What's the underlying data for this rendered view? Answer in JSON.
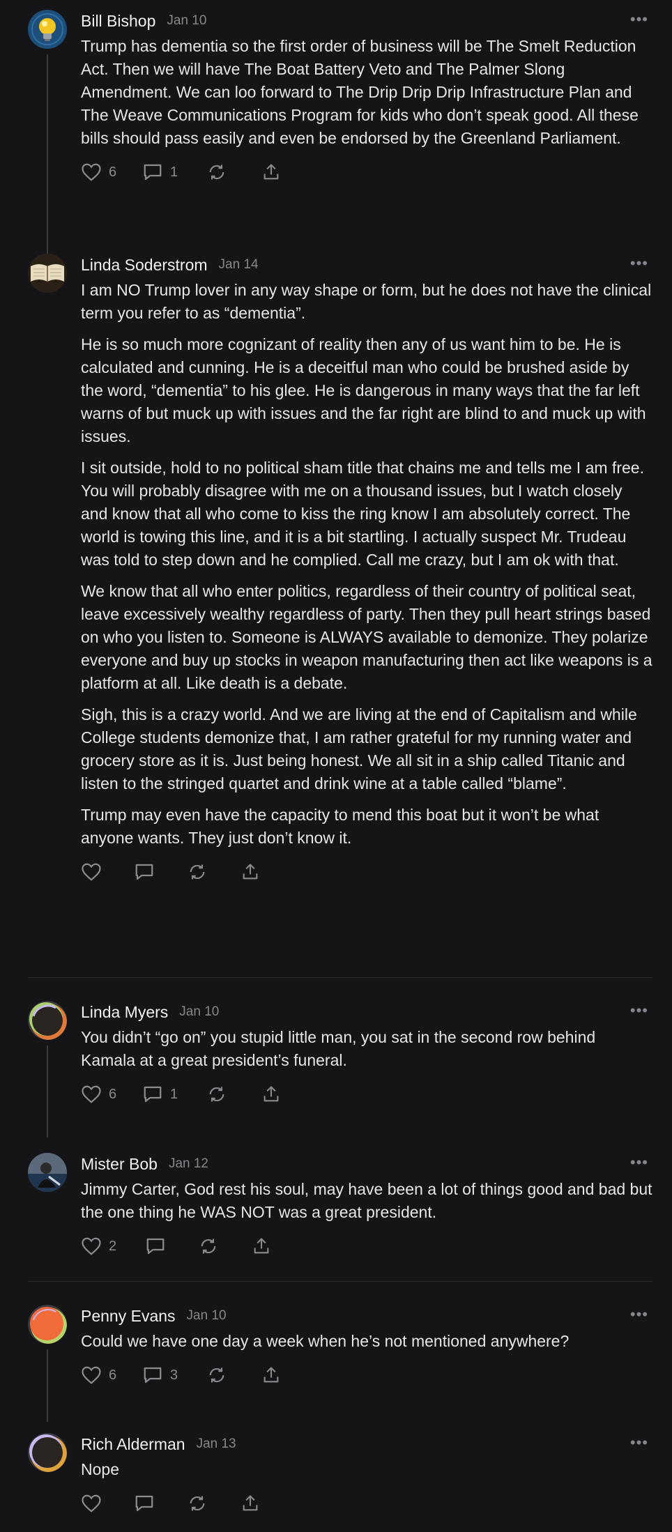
{
  "colors": {
    "background": "#151517",
    "text": "#e6e6e8",
    "muted": "#86868c",
    "thread_line": "#3a3a3e"
  },
  "icons": [
    "heart-icon",
    "comment-icon",
    "restack-icon",
    "share-icon",
    "more-icon"
  ],
  "comments": [
    {
      "name": "Bill Bishop",
      "date": "Jan 10",
      "avatar": "lightbulb",
      "paragraphs": [
        "Trump has dementia so the first order of business will be The Smelt Reduction Act. Then we will have The Boat Battery Veto and The Palmer Slong Amendment. We can loo forward to The Drip Drip Drip Infrastructure Plan and The Weave Communications Program for kids who don’t speak good. All these bills should pass easily and even be endorsed by the Greenland Parliament."
      ],
      "likes": "6",
      "replies": "1"
    },
    {
      "name": "Linda Soderstrom",
      "date": "Jan 14",
      "avatar": "book",
      "paragraphs": [
        "I am NO Trump lover in any way shape or form, but he does not have the clinical term you refer to as “dementia”.",
        "He is so much more cognizant of reality then any of us want him to be. He is calculated and cunning. He is a deceitful man who could be brushed aside by the word, “dementia” to his glee. He is dangerous in many ways that the far left warns of but muck up with issues and the far right are blind to and muck up with issues.",
        "I sit outside, hold to no political sham title that chains me and tells me I am free. You will probably disagree with me on a thousand issues, but I watch closely and know that all who come to kiss the ring know I am absolutely correct. The world is towing this line, and it is a bit startling. I actually suspect Mr. Trudeau was told to step down and he complied. Call me crazy, but I am ok with that.",
        "We know that all who enter politics, regardless of their country of political seat, leave excessively wealthy regardless of party. Then they pull heart strings based on who you listen to. Someone is ALWAYS available to demonize. They polarize everyone and buy up stocks in weapon manufacturing then act like weapons is a platform at all. Like death is a debate.",
        "Sigh, this is a crazy world. And we are living at the end of Capitalism and while College students demonize that, I am rather grateful for my running water and grocery store as it is. Just being honest. We all sit in a ship called Titanic and listen to the stringed quartet and drink wine at a table called “blame”.",
        "Trump may even have the capacity to mend this boat but it won’t be what anyone wants. They just don’t know it."
      ],
      "likes": "",
      "replies": ""
    },
    {
      "name": "Linda Myers",
      "date": "Jan 10",
      "avatar": "default",
      "paragraphs": [
        "You didn’t “go on” you stupid little man, you sat in the second row behind Kamala at a great president’s funeral."
      ],
      "likes": "6",
      "replies": "1"
    },
    {
      "name": "Mister Bob",
      "date": "Jan 12",
      "avatar": "photo",
      "paragraphs": [
        "Jimmy Carter, God rest his soul, may have been a lot of things good and bad but the one thing he WAS NOT was a great president."
      ],
      "likes": "2",
      "replies": ""
    },
    {
      "name": "Penny Evans",
      "date": "Jan 10",
      "avatar": "orange",
      "paragraphs": [
        "Could we have one day a week when he’s not mentioned anywhere?"
      ],
      "likes": "6",
      "replies": "3"
    },
    {
      "name": "Rich Alderman",
      "date": "Jan 13",
      "avatar": "default",
      "paragraphs": [
        "Nope"
      ],
      "likes": "",
      "replies": ""
    }
  ]
}
